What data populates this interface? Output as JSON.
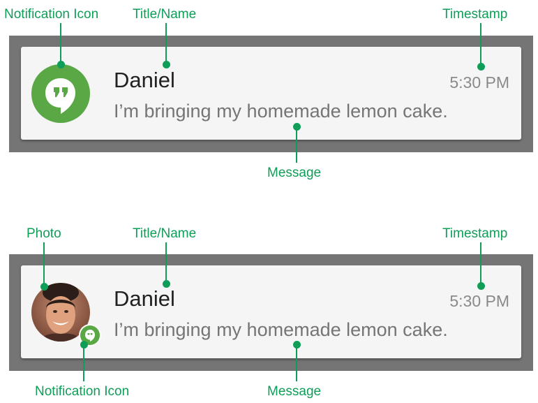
{
  "annotation_color": "#0f9d58",
  "icon_color": "#5aa845",
  "top_example": {
    "labels": {
      "notification_icon": "Notification Icon",
      "title_name": "Title/Name",
      "timestamp": "Timestamp",
      "message": "Message"
    },
    "notification": {
      "title": "Daniel",
      "message": "I’m bringing my homemade lemon cake.",
      "timestamp": "5:30 PM",
      "icon": "hangouts-quote-icon"
    }
  },
  "bottom_example": {
    "labels": {
      "photo": "Photo",
      "title_name": "Title/Name",
      "timestamp": "Timestamp",
      "notification_icon": "Notification Icon",
      "message": "Message"
    },
    "notification": {
      "title": "Daniel",
      "message": "I’m bringing my homemade lemon cake.",
      "timestamp": "5:30 PM",
      "photo": "contact-photo",
      "icon": "hangouts-quote-icon"
    }
  }
}
